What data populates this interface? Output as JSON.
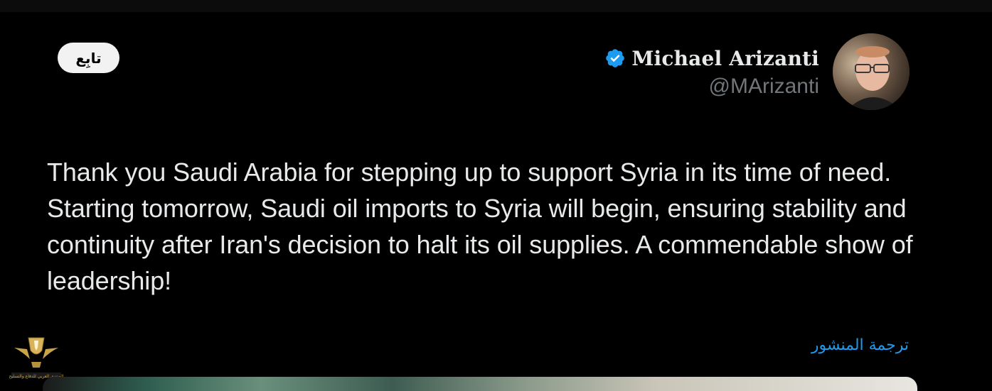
{
  "header": {
    "follow_label": "تابِع"
  },
  "author": {
    "name": "Michael Arizanti",
    "handle": "@MArizanti",
    "verified": true,
    "verified_color": "#1d9bf0"
  },
  "tweet": {
    "text": "Thank you Saudi Arabia for stepping up to support Syria in its time of need. Starting tomorrow, Saudi oil imports to Syria will begin, ensuring stability and continuity after Iran's decision to halt its oil supplies. A commendable show of leadership!"
  },
  "translate": {
    "label": "ترجمة المنشور"
  },
  "watermark": {
    "text": "المنتدى العربي للدفاع والتسليح"
  },
  "colors": {
    "background": "#000000",
    "text": "#e7e9ea",
    "secondary_text": "#71767b",
    "link": "#1d9bf0"
  }
}
